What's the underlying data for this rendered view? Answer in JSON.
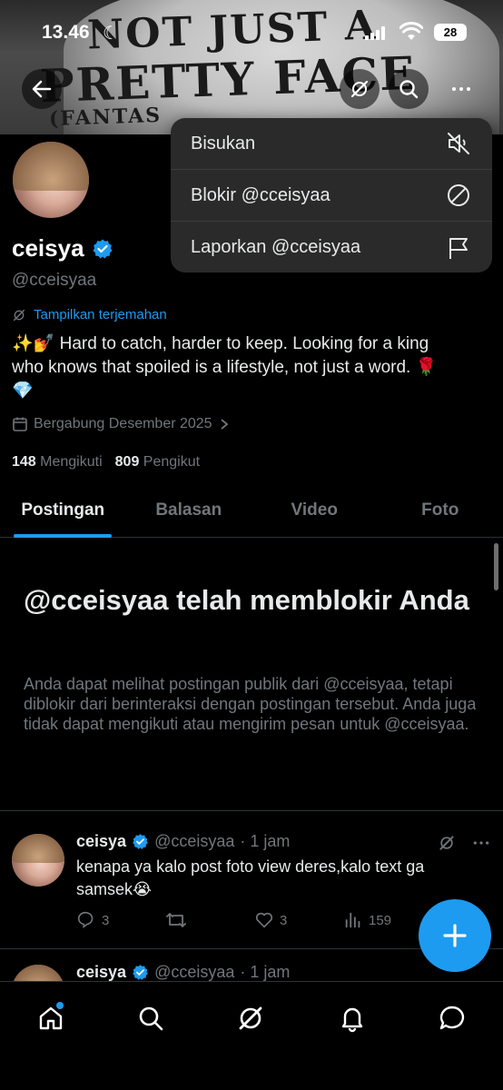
{
  "status_bar": {
    "time": "13.46",
    "battery": "28"
  },
  "banner": {
    "line1": "NOT JUST A",
    "line2": "PRETTY FACE",
    "line3": "(FANTAS"
  },
  "menu": {
    "items": [
      {
        "label": "Bisukan",
        "icon": "mute-icon"
      },
      {
        "label": "Blokir @cceisyaa",
        "icon": "block-icon"
      },
      {
        "label": "Laporkan @cceisyaa",
        "icon": "flag-icon"
      }
    ]
  },
  "profile": {
    "name": "ceisya",
    "handle": "@cceisyaa",
    "translate": "Tampilkan terjemahan",
    "bio_line1": "✨💅 Hard to catch, harder to keep. Looking for a king",
    "bio_line2": "who knows that spoiled is a lifestyle, not just a word. 🌹",
    "bio_line3": "💎",
    "joined": "Bergabung Desember 2025",
    "following_count": "148",
    "following_label": "Mengikuti",
    "followers_count": "809",
    "followers_label": "Pengikut"
  },
  "tabs": [
    "Postingan",
    "Balasan",
    "Video",
    "Foto"
  ],
  "blocked": {
    "title": "@cceisyaa telah memblokir Anda",
    "text": "Anda dapat melihat postingan publik dari @cceisyaa, tetapi diblokir dari berinteraksi dengan postingan tersebut. Anda juga tidak dapat mengikuti atau mengirim pesan untuk @cceisyaa."
  },
  "tweets": [
    {
      "name": "ceisya",
      "handle": "@cceisyaa",
      "time": "· 1 jam",
      "text": "kenapa ya kalo post foto view deres,kalo text ga samsek😭",
      "replies": "3",
      "retweets": "",
      "likes": "3",
      "views": "159"
    },
    {
      "name": "ceisya",
      "handle": "@cceisyaa",
      "time": "· 1 jam"
    }
  ],
  "colors": {
    "accent": "#1d9bf0",
    "background": "#000000",
    "muted": "#71767b"
  }
}
